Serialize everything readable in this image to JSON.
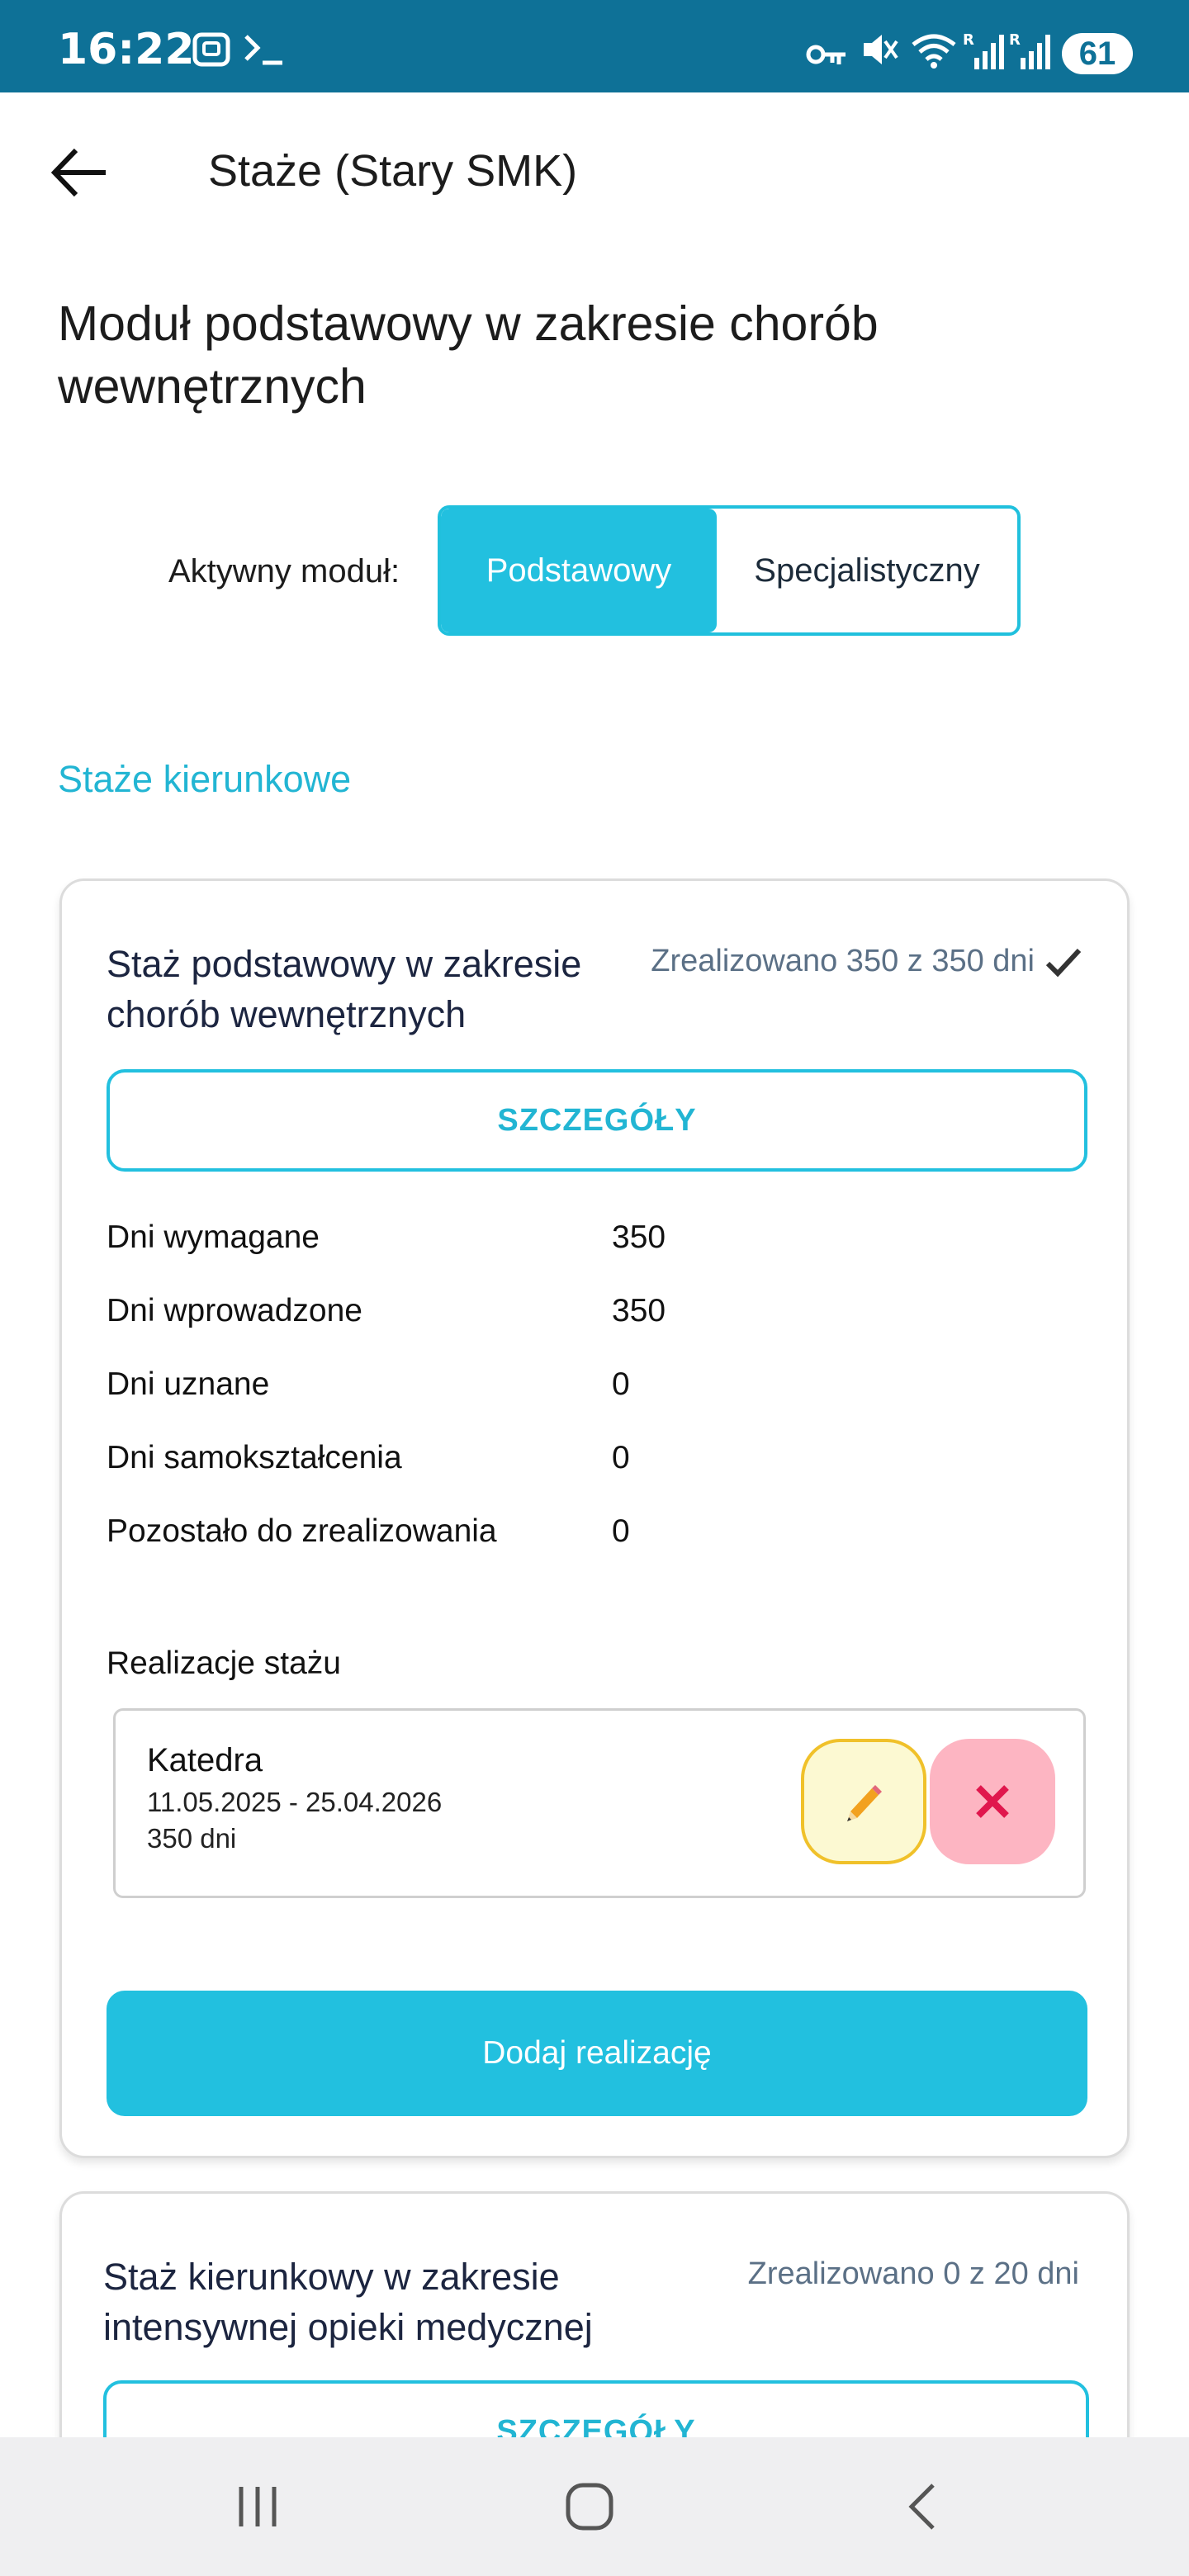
{
  "status_bar": {
    "time": "16:22",
    "battery": "61",
    "icons": [
      "screenshot-icon",
      "terminal-icon",
      "vpn-key-icon",
      "mute-icon",
      "wifi-icon",
      "signal-icon",
      "signal-icon"
    ]
  },
  "app_bar": {
    "title": "Staże (Stary SMK)",
    "back_icon": "arrow-left-icon"
  },
  "page": {
    "title": "Moduł podstawowy w zakresie chorób wewnętrznych",
    "module_label": "Aktywny moduł:",
    "module_options": [
      "Podstawowy",
      "Specjalistyczny"
    ],
    "selected_module": "Podstawowy",
    "section_title": "Staże kierunkowe"
  },
  "cards": [
    {
      "title": "Staż podstawowy w zakresie chorób wewnętrznych",
      "status": "Zrealizowano 350 z 350 dni",
      "completed": true,
      "details_label": "SZCZEGÓŁY",
      "stats": [
        {
          "label": "Dni wymagane",
          "value": "350"
        },
        {
          "label": "Dni wprowadzone",
          "value": "350"
        },
        {
          "label": "Dni uznane",
          "value": "0"
        },
        {
          "label": "Dni samokształcenia",
          "value": "0"
        },
        {
          "label": "Pozostało do zrealizowania",
          "value": "0"
        }
      ],
      "realizations_title": "Realizacje stażu",
      "realizations": [
        {
          "name": "Katedra",
          "dates": "11.05.2025 - 25.04.2026",
          "days": "350 dni"
        }
      ],
      "add_label": "Dodaj realizację"
    },
    {
      "title": "Staż kierunkowy w zakresie intensywnej opieki medycznej",
      "status": "Zrealizowano 0 z 20 dni",
      "completed": false,
      "details_label": "SZCZEGÓŁY"
    }
  ],
  "colors": {
    "status_bar": "#0e7197",
    "accent": "#22c0df",
    "edit_bg": "#fcf9d2",
    "edit_border": "#f0c12a",
    "delete_bg": "#fdb5c2",
    "delete_icon": "#e0174d"
  }
}
